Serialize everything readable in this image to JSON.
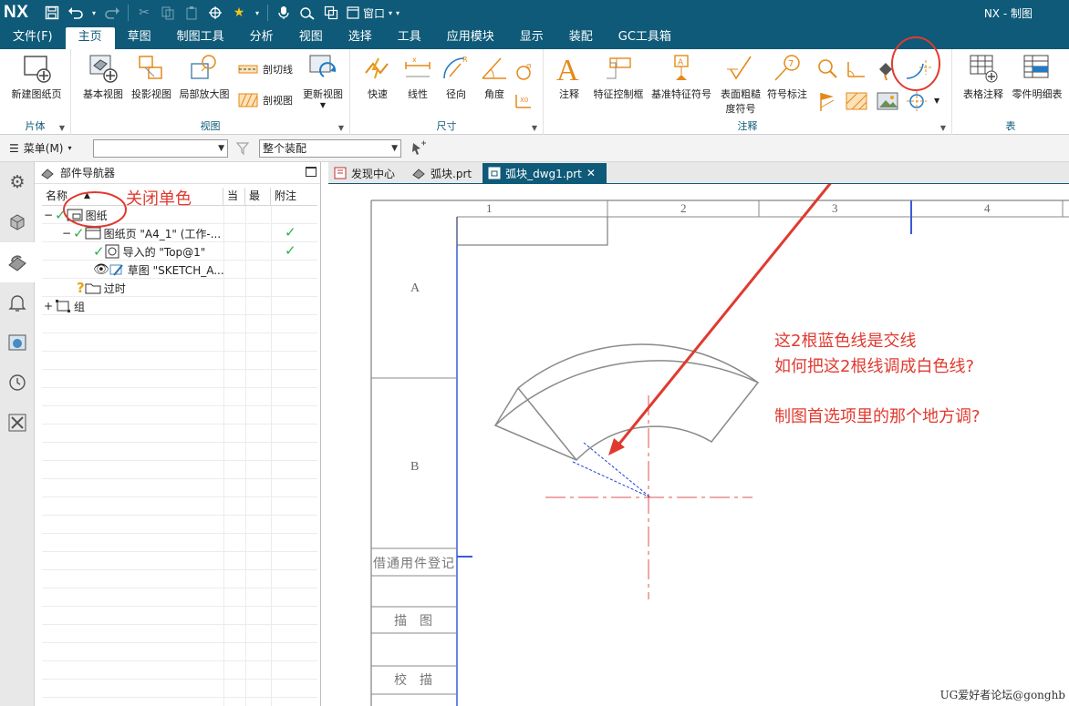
{
  "titlebar": {
    "logo": "NX",
    "window_menu": "窗口",
    "app_title": "NX - 制图"
  },
  "menu_tabs": [
    "文件(F)",
    "主页",
    "草图",
    "制图工具",
    "分析",
    "视图",
    "选择",
    "工具",
    "应用模块",
    "显示",
    "装配",
    "GC工具箱"
  ],
  "active_tab": "主页",
  "ribbon": {
    "sheet_group": {
      "label": "片体",
      "new_sheet": "新建图纸页"
    },
    "view_group": {
      "label": "视图",
      "base_view": "基本视图",
      "projected_view": "投影视图",
      "detail_view": "局部放大图",
      "section_line": "剖切线",
      "section_view": "剖视图",
      "update_view": "更新视图"
    },
    "dimension_group": {
      "label": "尺寸",
      "rapid": "快速",
      "linear": "线性",
      "radial": "径向",
      "angular": "角度"
    },
    "annotation_group": {
      "label": "注释",
      "note": "注释",
      "fcf": "特征控制框",
      "datum_symbol": "基准特征符号",
      "surface_finish_line1": "表面粗糙",
      "surface_finish_line2": "度符号",
      "id_symbol": "符号标注"
    },
    "table_group": {
      "label": "表",
      "tabular_note": "表格注释",
      "parts_list": "零件明细表"
    }
  },
  "selection_bar": {
    "menu_label": "菜单(M)",
    "filter_value": "",
    "scope_value": "整个装配"
  },
  "navigator": {
    "title": "部件导航器",
    "columns": [
      "名称",
      "当",
      "最",
      "附注"
    ],
    "items": [
      {
        "label": "图纸",
        "checked": true
      },
      {
        "label": "图纸页 \"A4_1\" (工作-...",
        "checked": true,
        "latest": true
      },
      {
        "label": "导入的 \"Top@1\"",
        "checked": true,
        "latest": true
      },
      {
        "label": "草图 \"SKETCH_A...",
        "checked": false
      },
      {
        "label": "过时",
        "checked": false
      },
      {
        "label": "组",
        "checked": false
      }
    ]
  },
  "doc_tabs": [
    {
      "label": "发现中心",
      "active": false
    },
    {
      "label": "弧块.prt",
      "active": false
    },
    {
      "label": "弧块_dwg1.prt",
      "active": true
    }
  ],
  "drawing": {
    "zone_numbers": [
      "1",
      "2",
      "3",
      "4"
    ],
    "zone_letters": [
      "A",
      "B"
    ],
    "title_block": [
      "借通用件登记",
      "描　图",
      "校　描"
    ]
  },
  "annotations": {
    "close_mono": "关闭单色",
    "line1": "这2根蓝色线是交线",
    "line2": "如何把这2根线调成白色线?",
    "line3": "制图首选项里的那个地方调?"
  },
  "watermark": "UG爱好者论坛@gonghb",
  "colors": {
    "titlebar": "#0e5a78",
    "annotation_red": "#e03a2f",
    "intersection_blue": "#1a3fd6",
    "centerline_red": "#e05050",
    "check_green": "#2bb14c"
  }
}
